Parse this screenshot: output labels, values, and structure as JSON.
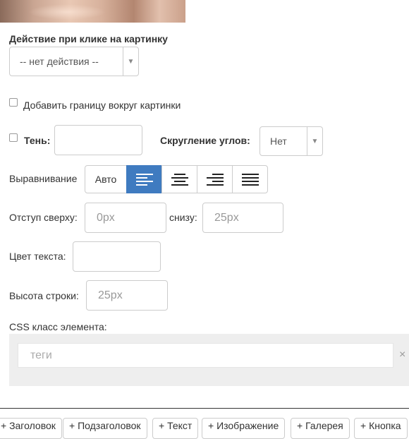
{
  "image_preview": {
    "icon": "image-thumbnail"
  },
  "click_action": {
    "label": "Действие при клике на картинку",
    "selected": "-- нет действия --"
  },
  "border": {
    "label": "Добавить границу вокруг картинки",
    "checked": false
  },
  "shadow": {
    "label": "Тень:",
    "checked": false,
    "value": ""
  },
  "rounding": {
    "label": "Скругление углов:",
    "selected": "Нет"
  },
  "alignment": {
    "label": "Выравнивание",
    "auto_label": "Авто",
    "options": [
      "left",
      "center",
      "right",
      "justify"
    ],
    "active": "left",
    "active_color": "#3f7bc0"
  },
  "padding": {
    "top_label": "Отступ сверху:",
    "top_placeholder": "0px",
    "bottom_label": "снизу:",
    "bottom_placeholder": "25px"
  },
  "text_color": {
    "label": "Цвет текста:",
    "value": ""
  },
  "line_height": {
    "label": "Высота строки:",
    "placeholder": "25px"
  },
  "css_class": {
    "label": "CSS класс элемента:",
    "placeholder": "теги",
    "clear": "×"
  },
  "add_buttons": [
    "+ Заголовок",
    "+ Подзаголовок",
    "+ Текст",
    "+ Изображение",
    "+ Галерея",
    "+ Кнопка"
  ]
}
